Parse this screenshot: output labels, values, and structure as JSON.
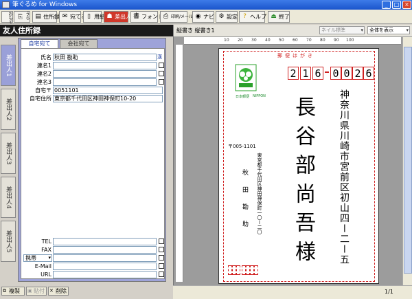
{
  "window": {
    "title": "筆ぐるめ for Windows"
  },
  "toolbar": {
    "buttons": [
      {
        "label": "おもて",
        "icon": "front-icon"
      },
      {
        "label": "うら",
        "icon": "back-icon"
      },
      {
        "label": "住所録",
        "icon": "addressbook-icon"
      },
      {
        "label": "宛てる",
        "icon": "address-icon"
      },
      {
        "label": "用紙",
        "icon": "paper-icon"
      },
      {
        "label": "差出人",
        "icon": "sender-icon"
      },
      {
        "label": "フォント",
        "icon": "font-icon"
      },
      {
        "label": "印刷/メール",
        "icon": "print-icon"
      },
      {
        "label": "ナビ",
        "icon": "navi-icon"
      },
      {
        "label": "設定",
        "icon": "settings-icon"
      },
      {
        "label": "ヘルプ",
        "icon": "help-icon"
      },
      {
        "label": "終了",
        "icon": "exit-icon"
      }
    ]
  },
  "left": {
    "header": "友人住所録",
    "side_tabs": [
      "差出人1",
      "差出人2",
      "差出人3",
      "差出人4",
      "差出人5"
    ],
    "form_tabs": [
      "自宅宛て",
      "会社宛て"
    ],
    "fields": [
      {
        "label": "氏名",
        "value": "秋田 勘助"
      },
      {
        "label": "連名1",
        "value": ""
      },
      {
        "label": "連名2",
        "value": ""
      },
      {
        "label": "連名3",
        "value": ""
      },
      {
        "label": "自宅〒",
        "value": "0051101"
      },
      {
        "label": "自宅住所",
        "value": "東京都千代田区神田神保町10-20"
      }
    ],
    "contact_fields": [
      {
        "label": "TEL",
        "value": ""
      },
      {
        "label": "FAX",
        "value": ""
      },
      {
        "label": "携帯",
        "value": ""
      },
      {
        "label": "E-Mail",
        "value": ""
      },
      {
        "label": "URL",
        "value": ""
      }
    ],
    "name_badge": "漢",
    "bottom_buttons": [
      "複製",
      "貼付",
      "削除"
    ]
  },
  "right": {
    "header_text": "縦書き 縦書き1",
    "font_select": "ネイル標準",
    "view_select": "全体を表示",
    "ruler_ticks": [
      "10",
      "20",
      "30",
      "40",
      "50",
      "60",
      "70",
      "80",
      "90",
      "100"
    ],
    "postcard": {
      "title": "郵便はがき",
      "zip": [
        "2",
        "1",
        "6",
        "0",
        "0",
        "2",
        "6"
      ],
      "recipient_address": "神奈川県川崎市宮前区初山四ー二ー五",
      "recipient_name": "長谷部尚吾様",
      "sender_zip": "〒005-1101",
      "sender_address": "東京都千代田区神田神保町一〇ー二〇",
      "sender_name": "秋田勘助",
      "stamp_label_left": "日本郵便",
      "stamp_label_right": "NIPPON"
    },
    "page_indicator": "1/1"
  },
  "colors": {
    "accent_red": "#d02020",
    "panel_blue": "#9ea3d9",
    "title_blue": "#1a55cc"
  }
}
